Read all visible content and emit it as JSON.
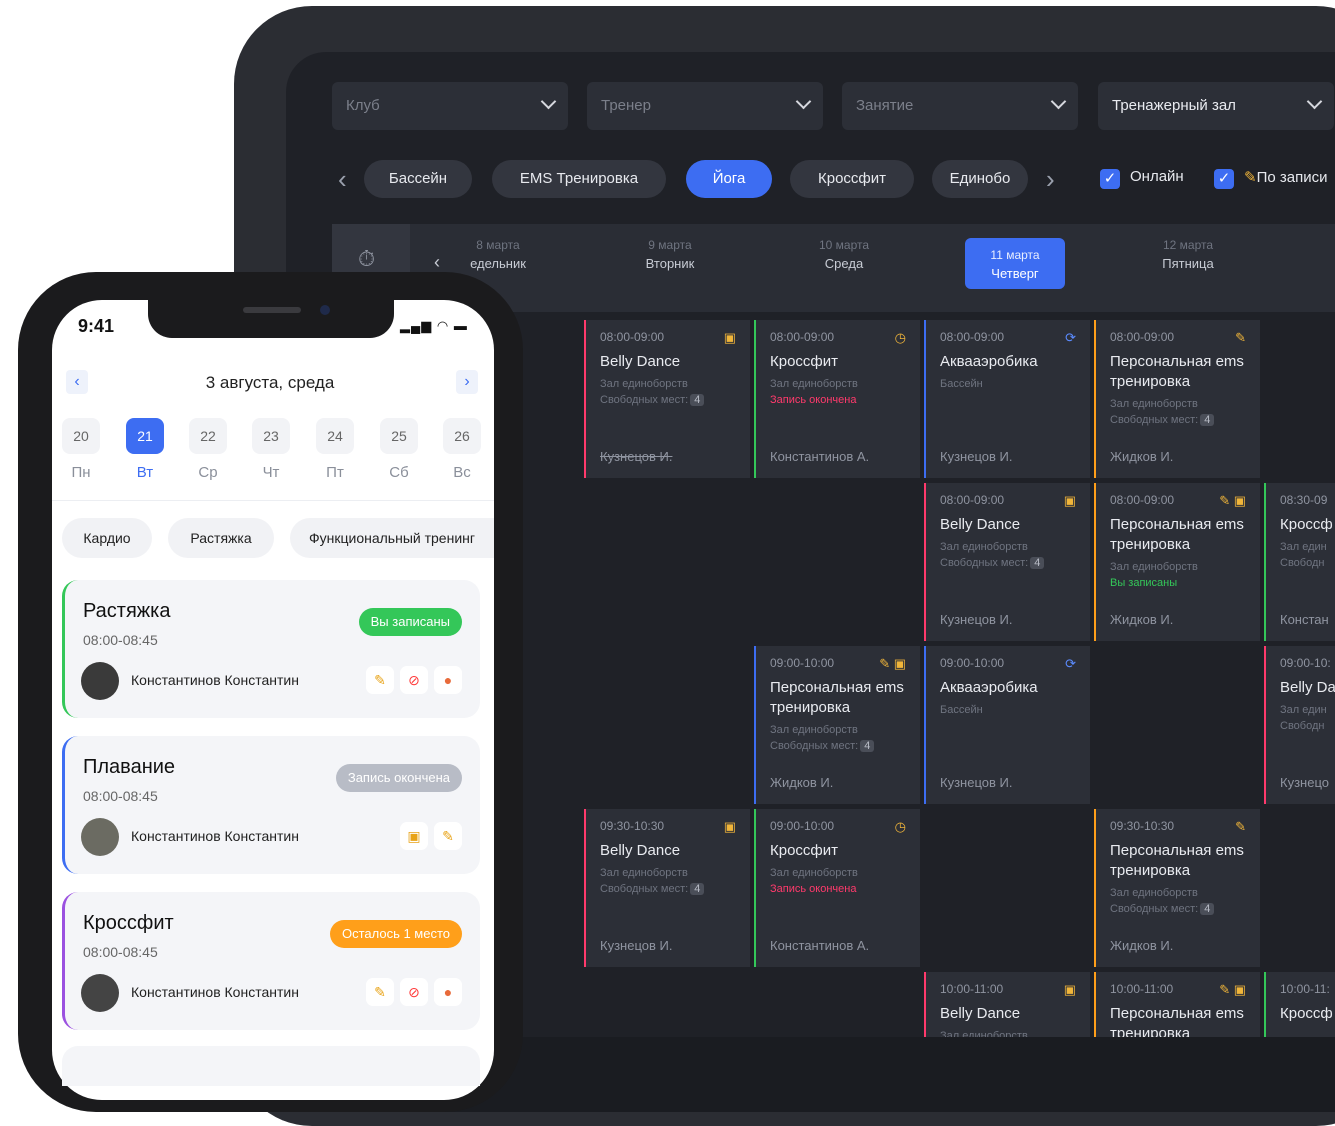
{
  "tablet": {
    "filters": [
      {
        "label": "Клуб",
        "active": false
      },
      {
        "label": "Тренер",
        "active": false
      },
      {
        "label": "Занятие",
        "active": false
      },
      {
        "label": "Тренажерный зал",
        "active": true
      }
    ],
    "chips": [
      "Бассейн",
      "EMS Тренировка",
      "Йога",
      "Кроссфит",
      "Единобо"
    ],
    "online_label": "Онлайн",
    "booking_label": "По записи",
    "days": [
      {
        "date": "8 марта",
        "name": "едельник"
      },
      {
        "date": "9 марта",
        "name": "Вторник"
      },
      {
        "date": "10 марта",
        "name": "Среда"
      },
      {
        "date": "11 марта",
        "name": "Четверг"
      },
      {
        "date": "12 марта",
        "name": "Пятница"
      }
    ],
    "cards": [
      {
        "time": "08:00-09:00",
        "name": "Belly Dance",
        "room": "Зал единоборств",
        "free": "Свободных мест:",
        "count": "4",
        "coach": "Кузнецов И."
      },
      {
        "time": "08:00-09:00",
        "name": "Кроссфит",
        "room": "Зал единоборств",
        "status": "Запись окончена",
        "coach": "Константинов А."
      },
      {
        "time": "08:00-09:00",
        "name": "Аквааэробика",
        "room": "Бассейн",
        "coach": "Кузнецов И."
      },
      {
        "time": "08:00-09:00",
        "name": "Персональная ems тренировка",
        "room": "Зал единоборств",
        "free": "Свободных мест:",
        "count": "4",
        "coach": "Жидков И."
      },
      {
        "time": "08:00-09:00",
        "name": "Belly Dance",
        "room": "Зал единоборств",
        "free": "Свободных мест:",
        "count": "4",
        "coach": "Кузнецов И."
      },
      {
        "time": "08:00-09:00",
        "name": "Персональная ems тренировка",
        "room": "Зал единоборств",
        "status": "Вы записаны",
        "coach": "Жидков И."
      },
      {
        "time": "08:30-09",
        "name": "Кроссф",
        "room": "Зал един",
        "free": "Свободн",
        "coach": "Констан"
      },
      {
        "time": "09:00-10:00",
        "name": "Персональная ems тренировка",
        "room": "Зал единоборств",
        "free": "Свободных мест:",
        "count": "4",
        "coach": "Жидков И."
      },
      {
        "time": "09:00-10:00",
        "name": "Аквааэробика",
        "room": "Бассейн",
        "coach": "Кузнецов И."
      },
      {
        "time": "09:00-10:",
        "name": "Belly Da",
        "room": "Зал един",
        "free": "Свободн",
        "coach": "Кузнецо"
      },
      {
        "time": "09:30-10:30",
        "name": "Belly Dance",
        "room": "Зал единоборств",
        "free": "Свободных мест:",
        "count": "4",
        "coach": "Кузнецов И."
      },
      {
        "time": "09:00-10:00",
        "name": "Кроссфит",
        "room": "Зал единоборств",
        "status": "Запись окончена",
        "coach": "Константинов А."
      },
      {
        "time": "09:30-10:30",
        "name": "Персональная ems тренировка",
        "room": "Зал единоборств",
        "free": "Свободных мест:",
        "count": "4",
        "coach": "Жидков И."
      },
      {
        "time": "10:00-11:00",
        "name": "Belly Dance",
        "room": "Зал единоборств"
      },
      {
        "time": "10:00-11:00",
        "name": "Персональная ems тренировка"
      },
      {
        "time": "10:00-11:",
        "name": "Кроссф"
      }
    ]
  },
  "phone": {
    "time": "9:41",
    "date_title": "3 августа, среда",
    "week": [
      {
        "num": "20",
        "day": "Пн"
      },
      {
        "num": "21",
        "day": "Вт"
      },
      {
        "num": "22",
        "day": "Ср"
      },
      {
        "num": "23",
        "day": "Чт"
      },
      {
        "num": "24",
        "day": "Пт"
      },
      {
        "num": "25",
        "day": "Сб"
      },
      {
        "num": "26",
        "day": "Вс"
      }
    ],
    "chips": [
      "Кардио",
      "Растяжка",
      "Функциональный тренинг"
    ],
    "classes": [
      {
        "title": "Растяжка",
        "time": "08:00-08:45",
        "badge": "Вы записаны",
        "trainer": "Константинов Константин"
      },
      {
        "title": "Плавание",
        "time": "08:00-08:45",
        "badge": "Запись окончена",
        "trainer": "Константинов Константин"
      },
      {
        "title": "Кроссфит",
        "time": "08:00-08:45",
        "badge": "Осталось 1 место",
        "trainer": "Константинов Константин"
      }
    ],
    "colors": {
      "accent": "#3d6df2",
      "green": "#34c759",
      "gray": "#b8bcc6",
      "orange": "#ff9f1a",
      "purple": "#9b51e0"
    }
  }
}
